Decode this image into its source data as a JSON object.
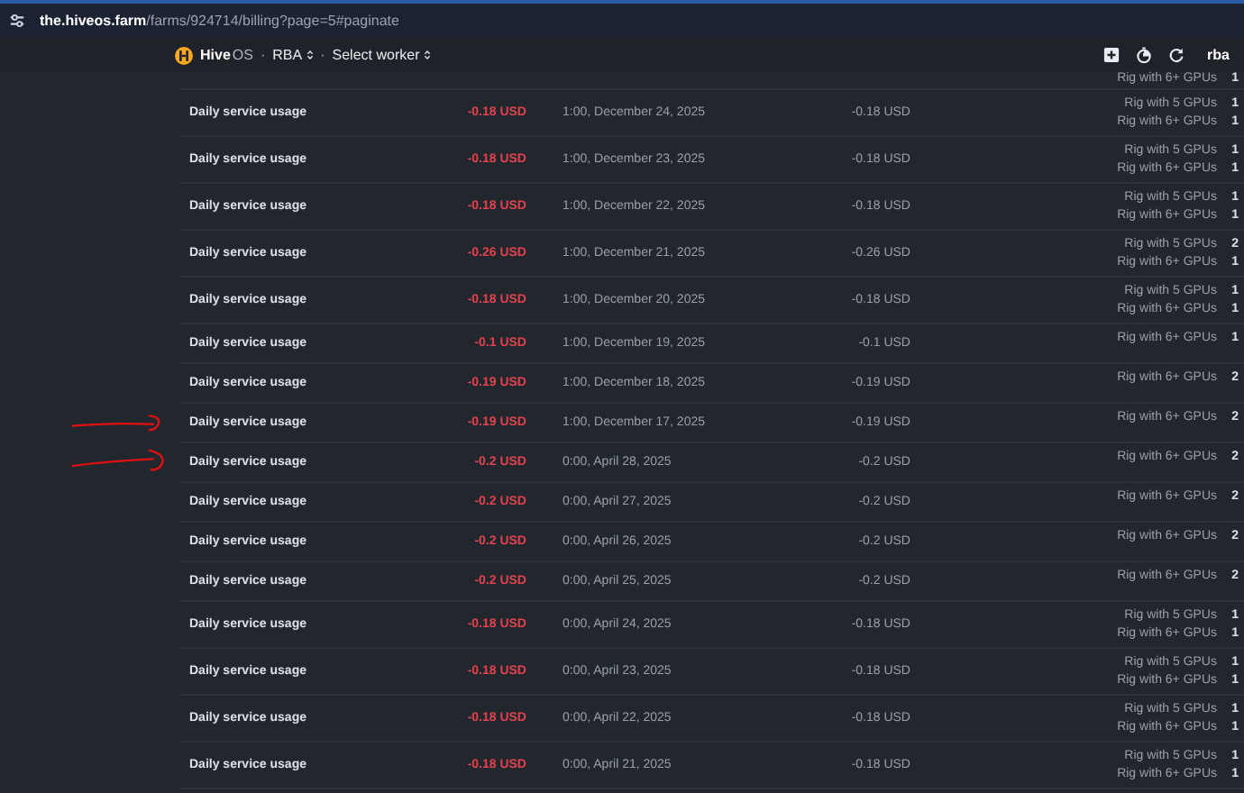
{
  "address_bar": {
    "host": "the.hiveos.farm",
    "path": "/farms/924714/billing?page=5#paginate"
  },
  "header": {
    "brand": "Hive",
    "brand_suffix": "OS",
    "separator_1": "·",
    "farm": "RBA",
    "separator_2": "·",
    "worker": "Select worker",
    "user": "rba"
  },
  "partial_row": {
    "rigs": [
      {
        "name": "Rig with 6+ GPUs",
        "count": "1"
      }
    ]
  },
  "rows": [
    {
      "description": "Daily service usage",
      "amount": "-0.18 USD",
      "date": "1:00, December 24, 2025",
      "balance": "-0.18 USD",
      "rigs": [
        {
          "name": "Rig with 5 GPUs",
          "count": "1"
        },
        {
          "name": "Rig with 6+ GPUs",
          "count": "1"
        }
      ]
    },
    {
      "description": "Daily service usage",
      "amount": "-0.18 USD",
      "date": "1:00, December 23, 2025",
      "balance": "-0.18 USD",
      "rigs": [
        {
          "name": "Rig with 5 GPUs",
          "count": "1"
        },
        {
          "name": "Rig with 6+ GPUs",
          "count": "1"
        }
      ]
    },
    {
      "description": "Daily service usage",
      "amount": "-0.18 USD",
      "date": "1:00, December 22, 2025",
      "balance": "-0.18 USD",
      "rigs": [
        {
          "name": "Rig with 5 GPUs",
          "count": "1"
        },
        {
          "name": "Rig with 6+ GPUs",
          "count": "1"
        }
      ]
    },
    {
      "description": "Daily service usage",
      "amount": "-0.26 USD",
      "date": "1:00, December 21, 2025",
      "balance": "-0.26 USD",
      "rigs": [
        {
          "name": "Rig with 5 GPUs",
          "count": "2"
        },
        {
          "name": "Rig with 6+ GPUs",
          "count": "1"
        }
      ]
    },
    {
      "description": "Daily service usage",
      "amount": "-0.18 USD",
      "date": "1:00, December 20, 2025",
      "balance": "-0.18 USD",
      "rigs": [
        {
          "name": "Rig with 5 GPUs",
          "count": "1"
        },
        {
          "name": "Rig with 6+ GPUs",
          "count": "1"
        }
      ]
    },
    {
      "description": "Daily service usage",
      "amount": "-0.1 USD",
      "date": "1:00, December 19, 2025",
      "balance": "-0.1 USD",
      "rigs": [
        {
          "name": "Rig with 6+ GPUs",
          "count": "1"
        }
      ]
    },
    {
      "description": "Daily service usage",
      "amount": "-0.19 USD",
      "date": "1:00, December 18, 2025",
      "balance": "-0.19 USD",
      "rigs": [
        {
          "name": "Rig with 6+ GPUs",
          "count": "2"
        }
      ]
    },
    {
      "description": "Daily service usage",
      "amount": "-0.19 USD",
      "date": "1:00, December 17, 2025",
      "balance": "-0.19 USD",
      "rigs": [
        {
          "name": "Rig with 6+ GPUs",
          "count": "2"
        }
      ]
    },
    {
      "description": "Daily service usage",
      "amount": "-0.2 USD",
      "date": "0:00, April 28, 2025",
      "balance": "-0.2 USD",
      "rigs": [
        {
          "name": "Rig with 6+ GPUs",
          "count": "2"
        }
      ]
    },
    {
      "description": "Daily service usage",
      "amount": "-0.2 USD",
      "date": "0:00, April 27, 2025",
      "balance": "-0.2 USD",
      "rigs": [
        {
          "name": "Rig with 6+ GPUs",
          "count": "2"
        }
      ]
    },
    {
      "description": "Daily service usage",
      "amount": "-0.2 USD",
      "date": "0:00, April 26, 2025",
      "balance": "-0.2 USD",
      "rigs": [
        {
          "name": "Rig with 6+ GPUs",
          "count": "2"
        }
      ]
    },
    {
      "description": "Daily service usage",
      "amount": "-0.2 USD",
      "date": "0:00, April 25, 2025",
      "balance": "-0.2 USD",
      "rigs": [
        {
          "name": "Rig with 6+ GPUs",
          "count": "2"
        }
      ]
    },
    {
      "description": "Daily service usage",
      "amount": "-0.18 USD",
      "date": "0:00, April 24, 2025",
      "balance": "-0.18 USD",
      "rigs": [
        {
          "name": "Rig with 5 GPUs",
          "count": "1"
        },
        {
          "name": "Rig with 6+ GPUs",
          "count": "1"
        }
      ]
    },
    {
      "description": "Daily service usage",
      "amount": "-0.18 USD",
      "date": "0:00, April 23, 2025",
      "balance": "-0.18 USD",
      "rigs": [
        {
          "name": "Rig with 5 GPUs",
          "count": "1"
        },
        {
          "name": "Rig with 6+ GPUs",
          "count": "1"
        }
      ]
    },
    {
      "description": "Daily service usage",
      "amount": "-0.18 USD",
      "date": "0:00, April 22, 2025",
      "balance": "-0.18 USD",
      "rigs": [
        {
          "name": "Rig with 5 GPUs",
          "count": "1"
        },
        {
          "name": "Rig with 6+ GPUs",
          "count": "1"
        }
      ]
    },
    {
      "description": "Daily service usage",
      "amount": "-0.18 USD",
      "date": "0:00, April 21, 2025",
      "balance": "-0.18 USD",
      "rigs": [
        {
          "name": "Rig with 5 GPUs",
          "count": "1"
        },
        {
          "name": "Rig with 6+ GPUs",
          "count": "1"
        }
      ]
    }
  ]
}
